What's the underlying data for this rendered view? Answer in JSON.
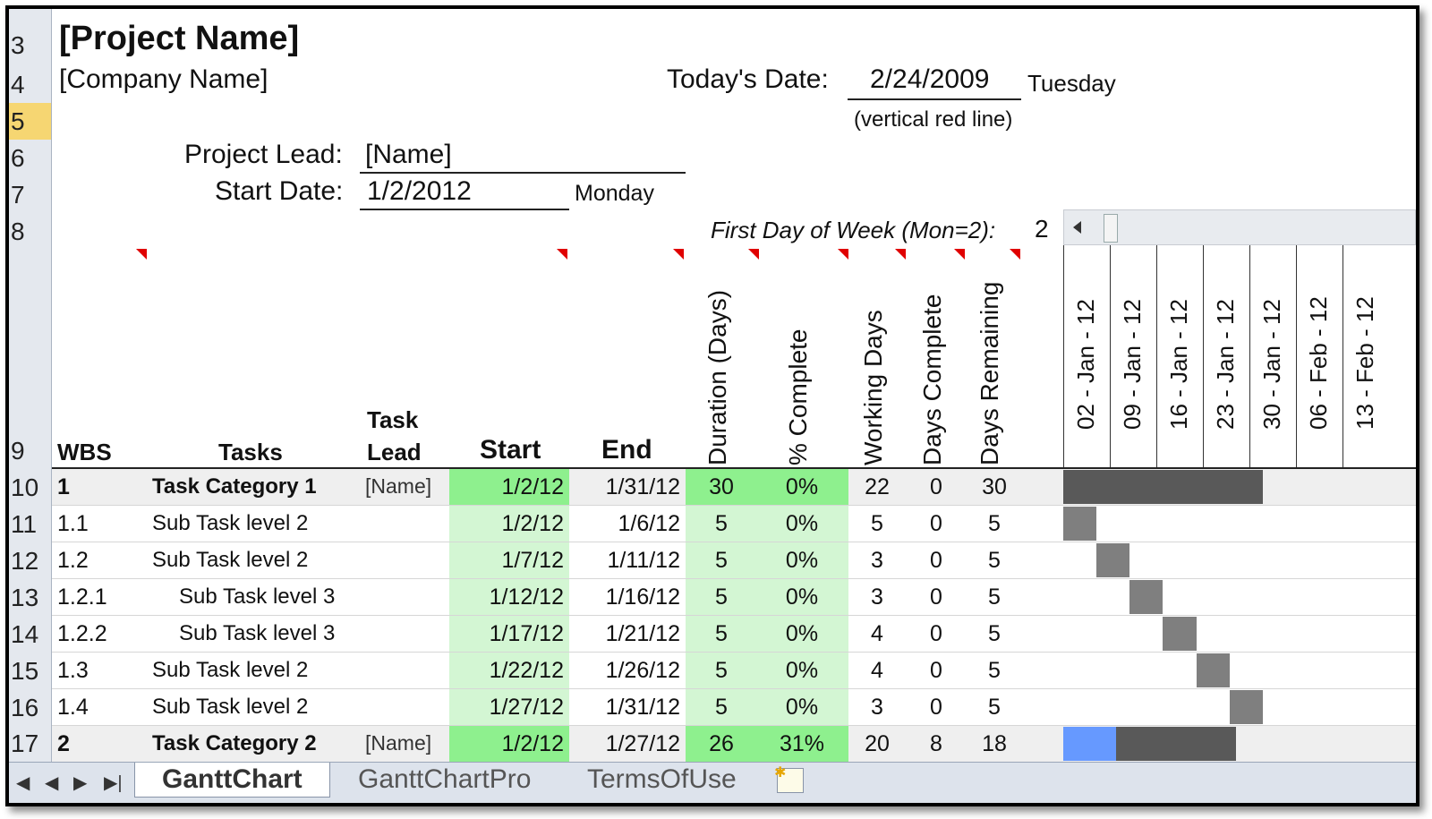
{
  "header": {
    "project_name": "[Project Name]",
    "company_name": "[Company Name]",
    "todays_date_label": "Today's Date:",
    "todays_date_value": "2/24/2009",
    "todays_day": "Tuesday",
    "red_line_note": "(vertical red line)",
    "project_lead_label": "Project Lead:",
    "project_lead_value": "[Name]",
    "start_date_label": "Start Date:",
    "start_date_value": "1/2/2012",
    "start_day": "Monday",
    "first_day_label": "First Day of Week (Mon=2):",
    "first_day_value": "2"
  },
  "row_numbers": [
    "3",
    "4",
    "5",
    "6",
    "7",
    "8",
    "9",
    "10",
    "11",
    "12",
    "13",
    "14",
    "15",
    "16",
    "17"
  ],
  "columns": {
    "wbs": "WBS",
    "tasks": "Tasks",
    "task_lead_1": "Task",
    "task_lead_2": "Lead",
    "start": "Start",
    "end": "End",
    "duration": "Duration (Days)",
    "pct_complete": "% Complete",
    "working_days": "Working Days",
    "days_complete": "Days Complete",
    "days_remaining": "Days Remaining"
  },
  "week_dates": [
    "02 - Jan - 12",
    "09 - Jan - 12",
    "16 - Jan - 12",
    "23 - Jan - 12",
    "30 - Jan - 12",
    "06 - Feb - 12",
    "13 - Feb - 12"
  ],
  "tasks": [
    {
      "wbs": "1",
      "name": "Task Category 1",
      "lead": "[Name]",
      "start": "1/2/12",
      "end": "1/31/12",
      "duration": "30",
      "pct": "0%",
      "working": "22",
      "done": "0",
      "remaining": "30"
    },
    {
      "wbs": "1.1",
      "name": "Sub Task level 2",
      "lead": "",
      "start": "1/2/12",
      "end": "1/6/12",
      "duration": "5",
      "pct": "0%",
      "working": "5",
      "done": "0",
      "remaining": "5"
    },
    {
      "wbs": "1.2",
      "name": "Sub Task level 2",
      "lead": "",
      "start": "1/7/12",
      "end": "1/11/12",
      "duration": "5",
      "pct": "0%",
      "working": "3",
      "done": "0",
      "remaining": "5"
    },
    {
      "wbs": "1.2.1",
      "name": "Sub Task level 3",
      "lead": "",
      "start": "1/12/12",
      "end": "1/16/12",
      "duration": "5",
      "pct": "0%",
      "working": "3",
      "done": "0",
      "remaining": "5"
    },
    {
      "wbs": "1.2.2",
      "name": "Sub Task level 3",
      "lead": "",
      "start": "1/17/12",
      "end": "1/21/12",
      "duration": "5",
      "pct": "0%",
      "working": "4",
      "done": "0",
      "remaining": "5"
    },
    {
      "wbs": "1.3",
      "name": "Sub Task level 2",
      "lead": "",
      "start": "1/22/12",
      "end": "1/26/12",
      "duration": "5",
      "pct": "0%",
      "working": "4",
      "done": "0",
      "remaining": "5"
    },
    {
      "wbs": "1.4",
      "name": "Sub Task level 2",
      "lead": "",
      "start": "1/27/12",
      "end": "1/31/12",
      "duration": "5",
      "pct": "0%",
      "working": "3",
      "done": "0",
      "remaining": "5"
    },
    {
      "wbs": "2",
      "name": "Task Category 2",
      "lead": "[Name]",
      "start": "1/2/12",
      "end": "1/27/12",
      "duration": "26",
      "pct": "31%",
      "working": "20",
      "done": "8",
      "remaining": "18"
    }
  ],
  "tabs": [
    "GanttChart",
    "GanttChartPro",
    "TermsOfUse"
  ],
  "colors": {
    "category_bar": "#595959",
    "task_bar": "#7f7f7f",
    "progress_bar": "#6699ff",
    "green_light": "#d3f6d3",
    "green_dark": "#8ef08e",
    "selected_row": "#f6d672"
  }
}
